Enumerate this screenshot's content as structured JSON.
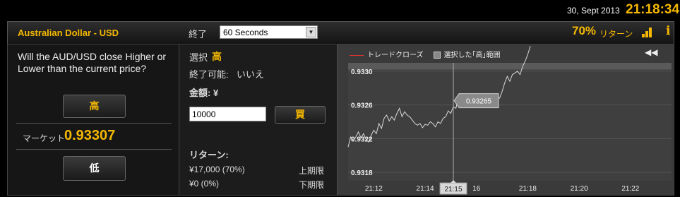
{
  "status": {
    "date": "30, Sept 2013",
    "time": "21:18:34"
  },
  "header": {
    "pair": "Australian Dollar - USD",
    "expiry_label": "終了",
    "expiry_value": "60 Seconds",
    "return_pct": "70%",
    "return_label": "リターン",
    "icons": [
      "bar-chart-icon",
      "info-icon"
    ],
    "accent_color": "#f5b800"
  },
  "left": {
    "question": "Will the AUD/USD close Higher or Lower than the current price?",
    "high_button": "高",
    "market_label": "マーケット",
    "market_value": "0.93307",
    "low_button": "低"
  },
  "mid": {
    "selection_label": "選択",
    "selection_value": "高",
    "can_close_label": "終了可能:",
    "can_close_value": "いいえ",
    "amount_label": "金額: ¥",
    "amount_value": "10000",
    "buy_button": "買",
    "returns_label": "リターン:",
    "upper_value": "¥17,000 (70%)",
    "upper_label": "上期限",
    "lower_value": "¥0 (0%)",
    "lower_label": "下期限"
  },
  "chart_panel": {
    "legend_trade_close": "トレードクローズ",
    "legend_selected_range": "選択した｢高｣範囲",
    "back_icon": "rewind-icon"
  },
  "chart_data": {
    "type": "line",
    "ylim": [
      0.9317,
      0.9331
    ],
    "yticks": [
      "0.9318",
      "0.9322",
      "0.9326",
      "0.9330"
    ],
    "xticks": [
      "21:12",
      "21:14",
      "21:15",
      "16",
      "21:18",
      "21:20",
      "21:22"
    ],
    "xlim_minutes": [
      11,
      23.6
    ],
    "cursor_x_label": "21:15",
    "cursor_x_minutes": 15.1,
    "strike_label": "0.93265",
    "strike_value": 0.93265,
    "colors": {
      "line": "#d8d8d8",
      "cursor": "#aaaaaa",
      "background": "#3a3a3a",
      "grid": "#555555"
    },
    "series": [
      {
        "x": [
          11.0,
          11.1,
          11.2,
          11.3,
          11.4,
          11.5,
          11.6,
          11.7,
          11.8,
          11.9,
          12.0,
          12.1,
          12.2,
          12.3,
          12.4,
          12.5,
          12.6,
          12.7,
          12.8,
          12.9,
          13.0,
          13.1,
          13.2,
          13.3,
          13.4,
          13.5,
          13.6,
          13.7,
          13.8,
          13.9,
          14.0,
          14.1,
          14.2,
          14.3,
          14.4,
          14.5,
          14.6,
          14.7,
          14.8,
          14.9,
          15.0,
          15.1,
          15.2,
          15.3,
          15.4,
          15.5,
          15.6,
          15.7,
          15.8,
          15.9,
          16.0,
          16.1,
          16.2,
          16.3,
          16.4,
          16.5,
          16.6,
          16.7,
          16.8,
          16.9,
          17.0,
          17.1,
          17.2,
          17.3,
          17.4,
          17.5,
          17.6,
          17.7,
          17.8,
          17.9,
          18.0,
          18.1
        ],
        "y": [
          0.9321,
          0.93222,
          0.93218,
          0.93222,
          0.93228,
          0.93221,
          0.93226,
          0.93219,
          0.93216,
          0.93224,
          0.9323,
          0.93226,
          0.93238,
          0.93232,
          0.93244,
          0.93248,
          0.93241,
          0.93246,
          0.93242,
          0.9325,
          0.93256,
          0.93246,
          0.93252,
          0.93248,
          0.93246,
          0.93242,
          0.93238,
          0.93236,
          0.93238,
          0.93233,
          0.93237,
          0.93236,
          0.9324,
          0.93238,
          0.93234,
          0.9324,
          0.93238,
          0.93244,
          0.93246,
          0.93253,
          0.9325,
          0.93258,
          0.93256,
          0.9327,
          0.9327,
          0.9327,
          0.9327,
          0.9327,
          0.9327,
          0.9327,
          0.93266,
          0.93268,
          0.93266,
          0.93267,
          0.93266,
          0.93268,
          0.93266,
          0.93266,
          0.9327,
          0.93268,
          0.93276,
          0.93286,
          0.93294,
          0.93288,
          0.93296,
          0.93298,
          0.933,
          0.93296,
          0.93306,
          0.93312,
          0.9332,
          0.9333
        ]
      }
    ]
  }
}
